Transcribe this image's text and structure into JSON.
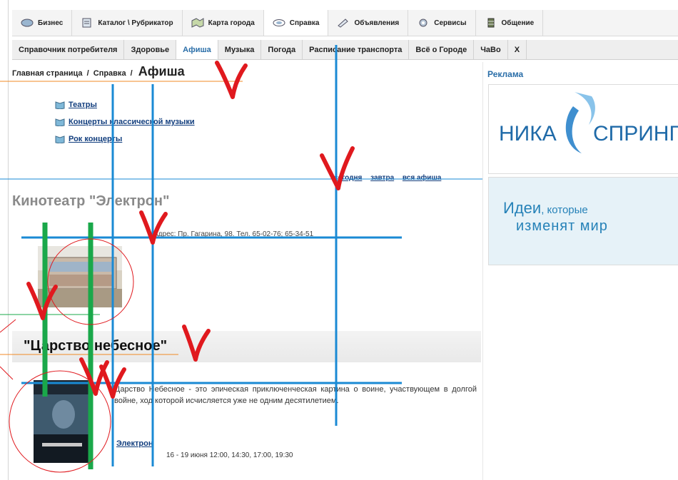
{
  "topnav": {
    "tabs": [
      {
        "label": "Бизнес",
        "icon": "business-icon"
      },
      {
        "label": "Каталог \\ Рубрикатор",
        "icon": "catalog-icon"
      },
      {
        "label": "Карта города",
        "icon": "map-icon"
      },
      {
        "label": "Справка",
        "icon": "reference-icon"
      },
      {
        "label": "Объявления",
        "icon": "ads-icon"
      },
      {
        "label": "Сервисы",
        "icon": "services-icon"
      },
      {
        "label": "Общение",
        "icon": "chat-icon"
      }
    ]
  },
  "subnav": {
    "items": [
      {
        "label": "Справочник потребителя"
      },
      {
        "label": "Здоровье"
      },
      {
        "label": "Афиша"
      },
      {
        "label": "Музыка"
      },
      {
        "label": "Погода"
      },
      {
        "label": "Расписание транспорта"
      },
      {
        "label": "Всё о Городе"
      },
      {
        "label": "ЧаВо"
      },
      {
        "label": "Х"
      }
    ]
  },
  "breadcrumb": {
    "home": "Главная страница",
    "section": "Справка",
    "current": "Афиша",
    "separator": "/"
  },
  "links": [
    "Театры",
    "Концерты классической музыки",
    "Рок концерты"
  ],
  "date_links": [
    "сегодня",
    "завтра",
    "вся афиша"
  ],
  "cinema": {
    "title": "Кинотеатр \"Электрон\"",
    "address": "Адрес: Пр. Гагарина, 98. Тел. 65-02-76; 65-34-51"
  },
  "film": {
    "title": "\"Царство небесное\"",
    "description": "Царство Небесное - это эпическая приключенческая картина о воине, участвующем в долгой войне, ход которой исчисляется уже не одним десятилетием.",
    "cinema_link": "Электрон",
    "times": "16 - 19 июня 12:00, 14:30, 17:00, 19:30"
  },
  "sidebar": {
    "ad_label": "Реклама",
    "ad1": {
      "left": "НИКА",
      "right": "СПРИНГ"
    },
    "ad2": {
      "line1_big": "Идеи",
      "line1_small": ", которые",
      "line2": "изменят мир"
    }
  },
  "colors": {
    "link": "#123e7e",
    "accent": "#2a6ea8",
    "annotation_blue": "#1a8ad4",
    "annotation_green": "#1aa84a",
    "annotation_red": "#e0191e",
    "annotation_orange": "#f08a24"
  }
}
